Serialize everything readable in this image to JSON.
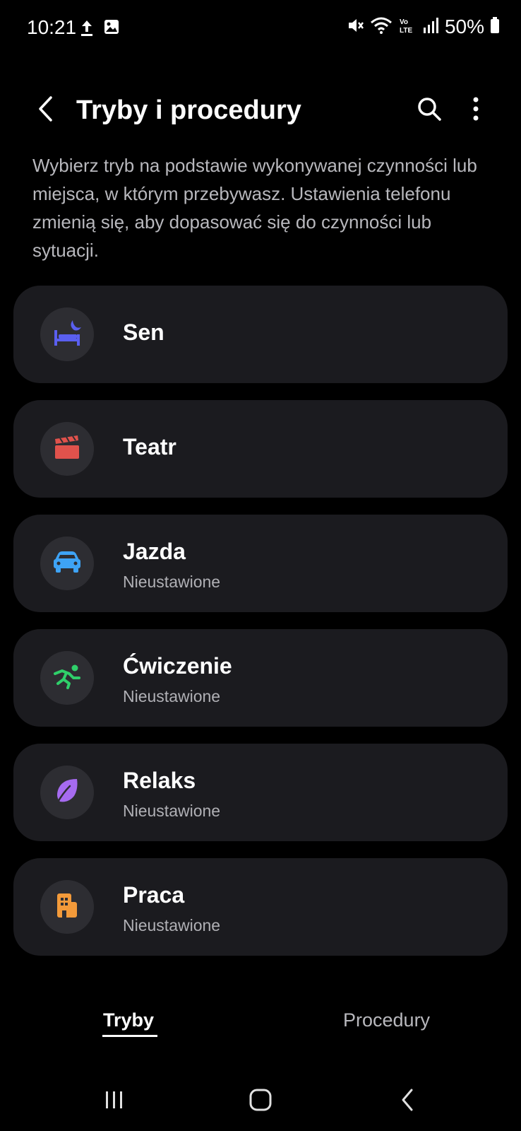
{
  "status_bar": {
    "time": "10:21",
    "battery": "50%",
    "left_icons": [
      "upload-icon",
      "image-icon"
    ],
    "right_icons": [
      "mute-icon",
      "wifi-icon",
      "volte-icon",
      "signal-icon",
      "battery-icon"
    ]
  },
  "header": {
    "title": "Tryby i procedury",
    "icons": [
      "back-icon",
      "search-icon",
      "more-icon"
    ]
  },
  "description": "Wybierz tryb na podstawie wykonywanej czynności lub miejsca, w którym przebywasz. Ustawienia telefonu zmienią się, aby dopasować się do czynności lub sytuacji.",
  "modes": [
    {
      "title": "Sen",
      "subtitle": "",
      "icon": "sleep-icon",
      "color": "#5a5ff0"
    },
    {
      "title": "Teatr",
      "subtitle": "",
      "icon": "clapper-icon",
      "color": "#e0524c"
    },
    {
      "title": "Jazda",
      "subtitle": "Nieustawione",
      "icon": "car-icon",
      "color": "#3ea3f5"
    },
    {
      "title": "Ćwiczenie",
      "subtitle": "Nieustawione",
      "icon": "running-icon",
      "color": "#2fcf6a"
    },
    {
      "title": "Relaks",
      "subtitle": "Nieustawione",
      "icon": "leaf-icon",
      "color": "#a66bf0"
    },
    {
      "title": "Praca",
      "subtitle": "Nieustawione",
      "icon": "building-icon",
      "color": "#f39a3a"
    }
  ],
  "tabs": {
    "active": "Tryby",
    "inactive": "Procedury"
  },
  "nav": [
    "recents-icon",
    "home-icon",
    "back-nav-icon"
  ]
}
